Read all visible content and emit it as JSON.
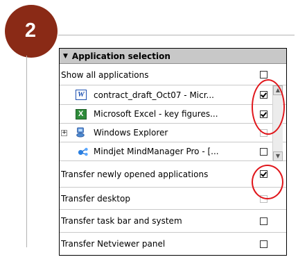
{
  "step_number": "2",
  "panel": {
    "title": "Application selection",
    "rows": [
      {
        "label": "Show all applications",
        "checked": false
      },
      {
        "label": "contract_draft_Oct07 - Micr...",
        "checked": true,
        "icon": "word-icon"
      },
      {
        "label": "Microsoft Excel - key figures...",
        "checked": true,
        "icon": "excel-icon"
      },
      {
        "label": "Windows Explorer",
        "checked": false,
        "icon": "explorer-icon"
      },
      {
        "label": "Mindjet MindManager Pro - [...",
        "checked": false,
        "icon": "mindmanager-icon"
      },
      {
        "label": "Transfer newly opened applications",
        "checked": true
      },
      {
        "label": "Transfer desktop",
        "checked": false
      },
      {
        "label": "Transfer task bar and system",
        "checked": false
      },
      {
        "label": "Transfer Netviewer panel",
        "checked": false
      }
    ]
  },
  "colors": {
    "badge": "#8a2a16",
    "highlight_circle": "#e0161b",
    "header_bg": "#c8c8c8"
  }
}
